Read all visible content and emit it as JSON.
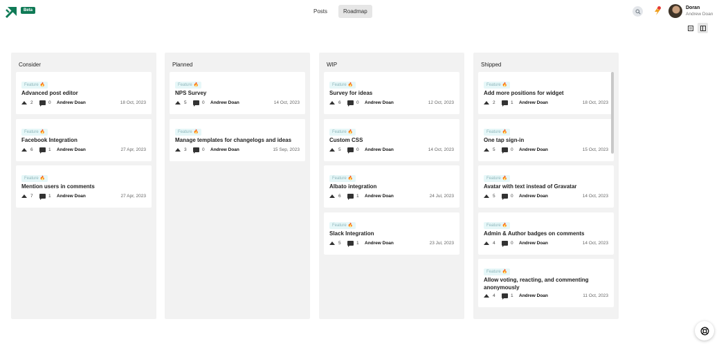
{
  "header": {
    "badge": "Beta",
    "nav": [
      {
        "label": "Posts"
      },
      {
        "label": "Roadmap",
        "active": true
      }
    ],
    "user": {
      "name": "Doran",
      "subtitle": "Andrew Doan"
    },
    "icons": {
      "logo": "app-logo",
      "search": "search-icon",
      "notifications": "bolt-icon",
      "list_view": "list-view-icon",
      "board_view": "board-view-icon",
      "help": "help-icon"
    },
    "colors": {
      "brand": "#0f7a56",
      "notification_dot": "#e53935",
      "tag_bg": "#e6f7f8",
      "tag_fire": "#f06b2a"
    }
  },
  "columns": [
    {
      "title": "Consider",
      "cards": [
        {
          "tag": "Feature",
          "title": "Advanced post editor",
          "votes": "2",
          "comments": "0",
          "author": "Andrew Doan",
          "date": "18 Oct, 2023"
        },
        {
          "tag": "Feature",
          "title": "Facebook Integration",
          "votes": "6",
          "comments": "1",
          "author": "Andrew Doan",
          "date": "27 Apr, 2023"
        },
        {
          "tag": "Feature",
          "title": "Mention users in comments",
          "votes": "7",
          "comments": "1",
          "author": "Andrew Doan",
          "date": "27 Apr, 2023"
        }
      ]
    },
    {
      "title": "Planned",
      "cards": [
        {
          "tag": "Feature",
          "title": "NPS Survey",
          "votes": "5",
          "comments": "0",
          "author": "Andrew Doan",
          "date": "14 Oct, 2023"
        },
        {
          "tag": "Feature",
          "title": "Manage templates for changelogs and ideas",
          "votes": "3",
          "comments": "0",
          "author": "Andrew Doan",
          "date": "15 Sep, 2023"
        }
      ]
    },
    {
      "title": "WIP",
      "cards": [
        {
          "tag": "Feature",
          "title": "Survey for ideas",
          "votes": "6",
          "comments": "0",
          "author": "Andrew Doan",
          "date": "12 Oct, 2023"
        },
        {
          "tag": "Feature",
          "title": "Custom CSS",
          "votes": "5",
          "comments": "0",
          "author": "Andrew Doan",
          "date": "14 Oct, 2023"
        },
        {
          "tag": "Feature",
          "title": "Albato integration",
          "votes": "6",
          "comments": "1",
          "author": "Andrew Doan",
          "date": "24 Jul, 2023"
        },
        {
          "tag": "Feature",
          "title": "Slack Integration",
          "votes": "5",
          "comments": "1",
          "author": "Andrew Doan",
          "date": "23 Jul, 2023"
        }
      ]
    },
    {
      "title": "Shipped",
      "cards": [
        {
          "tag": "Feature",
          "title": "Add more positions for widget",
          "votes": "2",
          "comments": "1",
          "author": "Andrew Doan",
          "date": "18 Oct, 2023"
        },
        {
          "tag": "Feature",
          "title": "One tap sign-in",
          "votes": "5",
          "comments": "0",
          "author": "Andrew Doan",
          "date": "15 Oct, 2023"
        },
        {
          "tag": "Feature",
          "title": "Avatar with text instead of Gravatar",
          "votes": "5",
          "comments": "0",
          "author": "Andrew Doan",
          "date": "14 Oct, 2023"
        },
        {
          "tag": "Feature",
          "title": "Admin & Author badges on comments",
          "votes": "4",
          "comments": "0",
          "author": "Andrew Doan",
          "date": "14 Oct, 2023"
        },
        {
          "tag": "Feature",
          "title": "Allow voting, reacting, and commenting anonymously",
          "votes": "4",
          "comments": "1",
          "author": "Andrew Doan",
          "date": "11 Oct, 2023"
        }
      ]
    }
  ]
}
